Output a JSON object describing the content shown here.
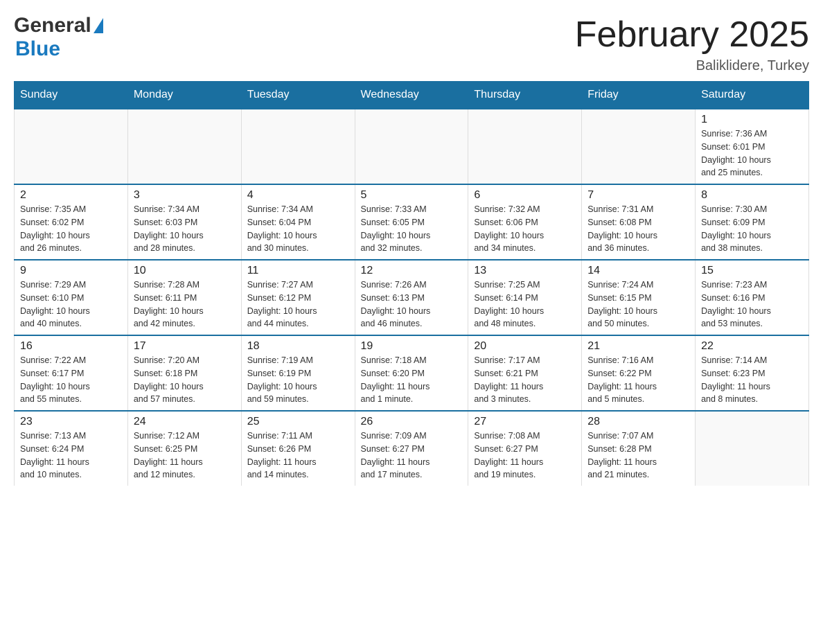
{
  "header": {
    "logo_general": "General",
    "logo_blue": "Blue",
    "title": "February 2025",
    "subtitle": "Baliklidere, Turkey"
  },
  "days_of_week": [
    "Sunday",
    "Monday",
    "Tuesday",
    "Wednesday",
    "Thursday",
    "Friday",
    "Saturday"
  ],
  "weeks": [
    [
      {
        "day": "",
        "info": ""
      },
      {
        "day": "",
        "info": ""
      },
      {
        "day": "",
        "info": ""
      },
      {
        "day": "",
        "info": ""
      },
      {
        "day": "",
        "info": ""
      },
      {
        "day": "",
        "info": ""
      },
      {
        "day": "1",
        "info": "Sunrise: 7:36 AM\nSunset: 6:01 PM\nDaylight: 10 hours\nand 25 minutes."
      }
    ],
    [
      {
        "day": "2",
        "info": "Sunrise: 7:35 AM\nSunset: 6:02 PM\nDaylight: 10 hours\nand 26 minutes."
      },
      {
        "day": "3",
        "info": "Sunrise: 7:34 AM\nSunset: 6:03 PM\nDaylight: 10 hours\nand 28 minutes."
      },
      {
        "day": "4",
        "info": "Sunrise: 7:34 AM\nSunset: 6:04 PM\nDaylight: 10 hours\nand 30 minutes."
      },
      {
        "day": "5",
        "info": "Sunrise: 7:33 AM\nSunset: 6:05 PM\nDaylight: 10 hours\nand 32 minutes."
      },
      {
        "day": "6",
        "info": "Sunrise: 7:32 AM\nSunset: 6:06 PM\nDaylight: 10 hours\nand 34 minutes."
      },
      {
        "day": "7",
        "info": "Sunrise: 7:31 AM\nSunset: 6:08 PM\nDaylight: 10 hours\nand 36 minutes."
      },
      {
        "day": "8",
        "info": "Sunrise: 7:30 AM\nSunset: 6:09 PM\nDaylight: 10 hours\nand 38 minutes."
      }
    ],
    [
      {
        "day": "9",
        "info": "Sunrise: 7:29 AM\nSunset: 6:10 PM\nDaylight: 10 hours\nand 40 minutes."
      },
      {
        "day": "10",
        "info": "Sunrise: 7:28 AM\nSunset: 6:11 PM\nDaylight: 10 hours\nand 42 minutes."
      },
      {
        "day": "11",
        "info": "Sunrise: 7:27 AM\nSunset: 6:12 PM\nDaylight: 10 hours\nand 44 minutes."
      },
      {
        "day": "12",
        "info": "Sunrise: 7:26 AM\nSunset: 6:13 PM\nDaylight: 10 hours\nand 46 minutes."
      },
      {
        "day": "13",
        "info": "Sunrise: 7:25 AM\nSunset: 6:14 PM\nDaylight: 10 hours\nand 48 minutes."
      },
      {
        "day": "14",
        "info": "Sunrise: 7:24 AM\nSunset: 6:15 PM\nDaylight: 10 hours\nand 50 minutes."
      },
      {
        "day": "15",
        "info": "Sunrise: 7:23 AM\nSunset: 6:16 PM\nDaylight: 10 hours\nand 53 minutes."
      }
    ],
    [
      {
        "day": "16",
        "info": "Sunrise: 7:22 AM\nSunset: 6:17 PM\nDaylight: 10 hours\nand 55 minutes."
      },
      {
        "day": "17",
        "info": "Sunrise: 7:20 AM\nSunset: 6:18 PM\nDaylight: 10 hours\nand 57 minutes."
      },
      {
        "day": "18",
        "info": "Sunrise: 7:19 AM\nSunset: 6:19 PM\nDaylight: 10 hours\nand 59 minutes."
      },
      {
        "day": "19",
        "info": "Sunrise: 7:18 AM\nSunset: 6:20 PM\nDaylight: 11 hours\nand 1 minute."
      },
      {
        "day": "20",
        "info": "Sunrise: 7:17 AM\nSunset: 6:21 PM\nDaylight: 11 hours\nand 3 minutes."
      },
      {
        "day": "21",
        "info": "Sunrise: 7:16 AM\nSunset: 6:22 PM\nDaylight: 11 hours\nand 5 minutes."
      },
      {
        "day": "22",
        "info": "Sunrise: 7:14 AM\nSunset: 6:23 PM\nDaylight: 11 hours\nand 8 minutes."
      }
    ],
    [
      {
        "day": "23",
        "info": "Sunrise: 7:13 AM\nSunset: 6:24 PM\nDaylight: 11 hours\nand 10 minutes."
      },
      {
        "day": "24",
        "info": "Sunrise: 7:12 AM\nSunset: 6:25 PM\nDaylight: 11 hours\nand 12 minutes."
      },
      {
        "day": "25",
        "info": "Sunrise: 7:11 AM\nSunset: 6:26 PM\nDaylight: 11 hours\nand 14 minutes."
      },
      {
        "day": "26",
        "info": "Sunrise: 7:09 AM\nSunset: 6:27 PM\nDaylight: 11 hours\nand 17 minutes."
      },
      {
        "day": "27",
        "info": "Sunrise: 7:08 AM\nSunset: 6:27 PM\nDaylight: 11 hours\nand 19 minutes."
      },
      {
        "day": "28",
        "info": "Sunrise: 7:07 AM\nSunset: 6:28 PM\nDaylight: 11 hours\nand 21 minutes."
      },
      {
        "day": "",
        "info": ""
      }
    ]
  ]
}
